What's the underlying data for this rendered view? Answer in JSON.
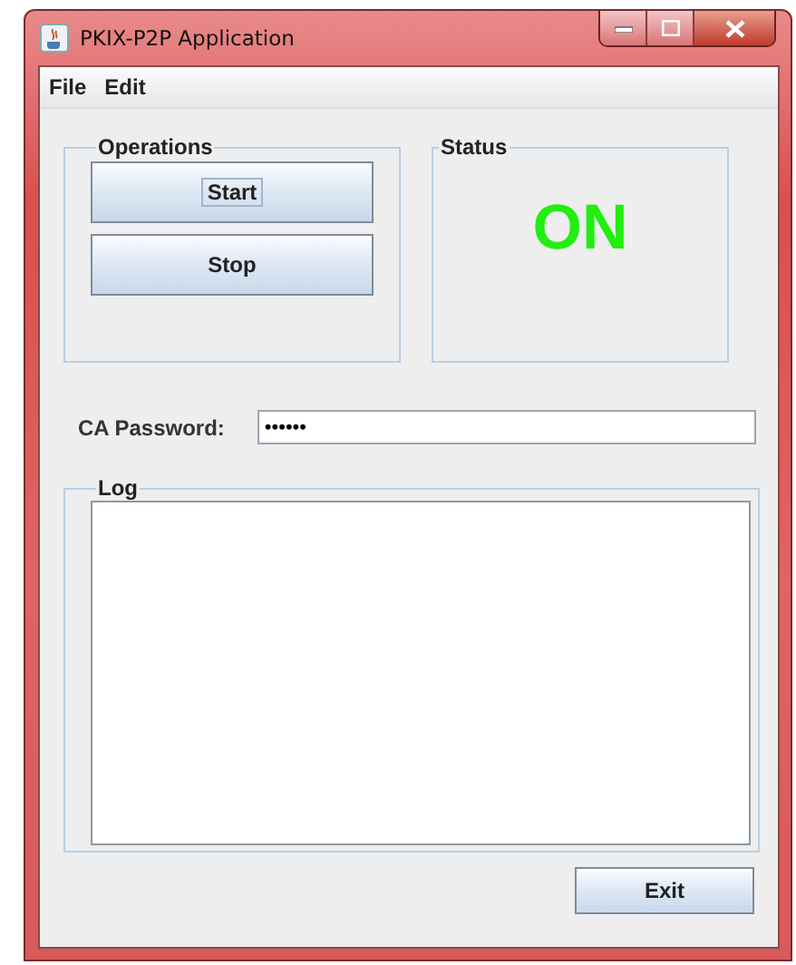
{
  "window": {
    "title": "PKIX-P2P Application"
  },
  "menu": [
    "File",
    "Edit"
  ],
  "operations": {
    "title": "Operations",
    "buttons": [
      {
        "label": "Start",
        "focused": true
      },
      {
        "label": "Stop",
        "focused": false
      }
    ]
  },
  "status": {
    "title": "Status",
    "value": "ON"
  },
  "password": {
    "label": "CA Password:",
    "value": "••••••"
  },
  "log": {
    "title": "Log"
  },
  "exit_button": "Exit"
}
